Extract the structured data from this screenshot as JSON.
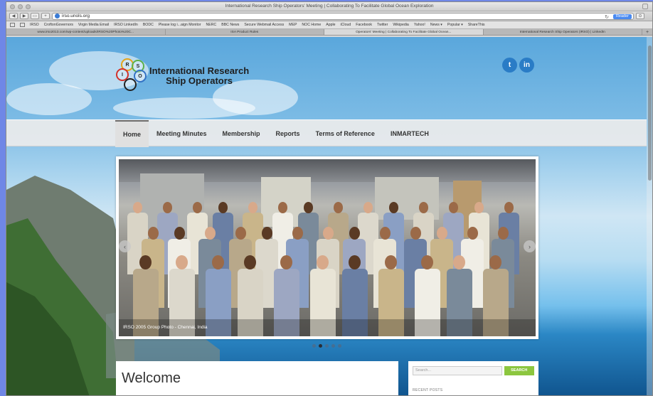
{
  "browser": {
    "window_title": "International Research Ship Operators' Meeting | Collaborating To Facilitate Global Ocean Exploration",
    "url": "irso.unols.org",
    "reader_label": "Reader",
    "bookmarks": [
      "IRSO",
      "CroftonGovernors",
      "Virgin Media Email",
      "IRSO LinkedIn",
      "BODC",
      "Please log i...aign Monitor",
      "NERC",
      "BBC News",
      "Secure Webmail Access",
      "MEP",
      "NOC Home",
      "Apple",
      "iCloud",
      "Facebook",
      "Twitter",
      "Wikipedia",
      "Yahoo!",
      "News ▾",
      "Popular ▾",
      "ShareThis"
    ],
    "tabs": [
      {
        "label": "www.irso2013.com/wp-content/uploads/IRSO%20Photo%20C...",
        "active": false
      },
      {
        "label": "ISA Product Rules",
        "active": false
      },
      {
        "label": "Operators' Meeting | Collaborating To Facilitate Global Ocean...",
        "active": true
      },
      {
        "label": "International Research Ship Operators (IRSO) | LinkedIn",
        "active": false
      }
    ]
  },
  "site": {
    "logo_letters": [
      "R",
      "S",
      "I",
      "O"
    ],
    "logo_line1": "International Research",
    "logo_line2": "Ship Operators",
    "social": [
      {
        "name": "twitter-icon",
        "glyph": "t"
      },
      {
        "name": "linkedin-icon",
        "glyph": "in"
      }
    ],
    "nav": [
      {
        "label": "Home",
        "active": true
      },
      {
        "label": "Meeting Minutes",
        "active": false
      },
      {
        "label": "Membership",
        "active": false
      },
      {
        "label": "Reports",
        "active": false
      },
      {
        "label": "Terms of Reference",
        "active": false
      },
      {
        "label": "INMARTECH",
        "active": false
      }
    ],
    "slider": {
      "caption": "IRSO 2005 Group Photo - Chennai, India",
      "slide_count": 5,
      "active_slide": 2
    },
    "welcome_title": "Welcome",
    "search": {
      "placeholder": "Search...",
      "button_label": "SEARCH"
    },
    "recent_posts_heading": "RECENT POSTS"
  }
}
